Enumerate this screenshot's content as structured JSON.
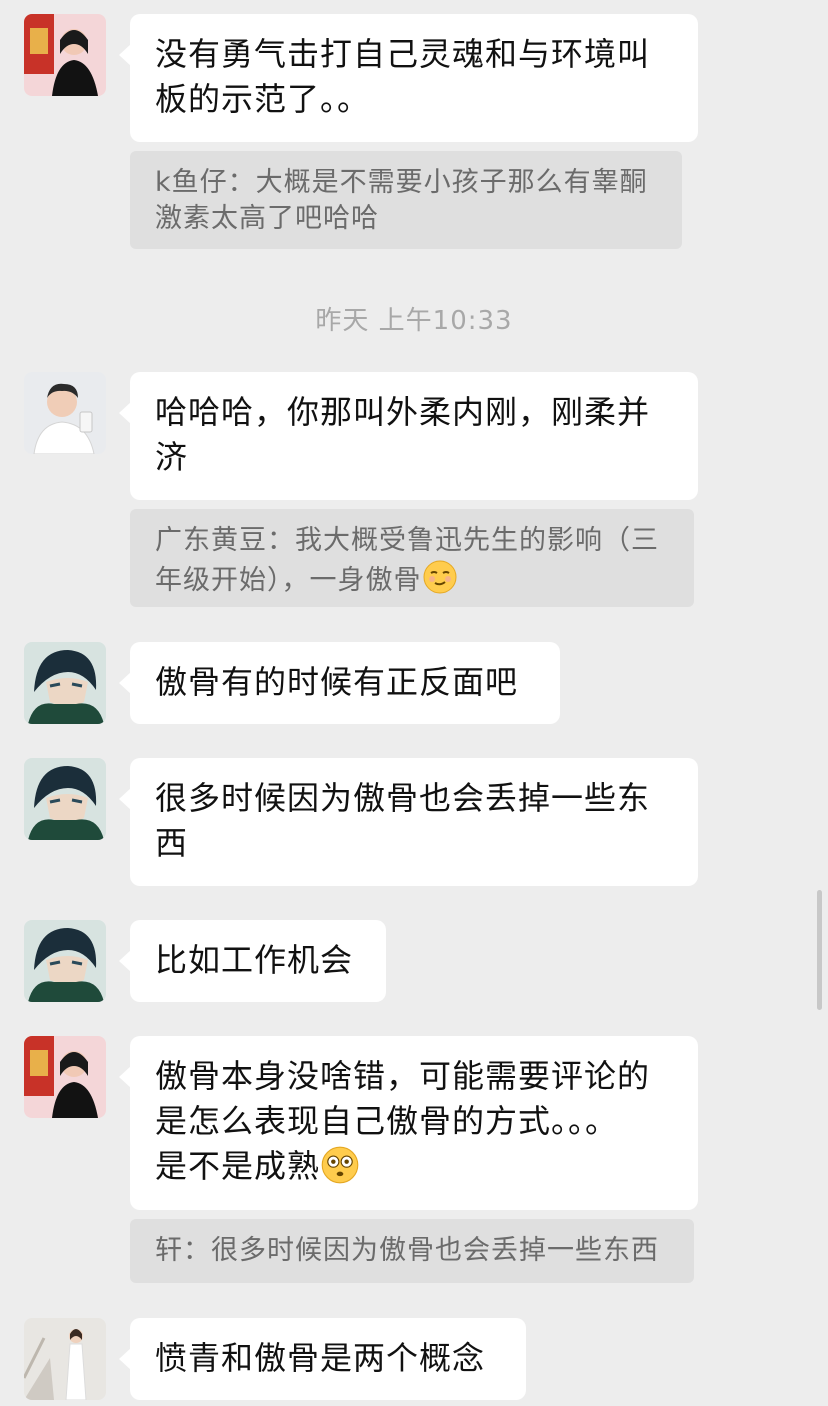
{
  "timestamp": "昨天 上午10:33",
  "messages": [
    {
      "sender": "avatar-woman-red",
      "lines": [
        "没有勇气击打自己灵魂和与环境叫",
        "板的示范了。。"
      ]
    },
    {
      "quote": [
        "k鱼仔：大概是不需要小孩子那么有睾酮",
        "激素太高了吧哈哈"
      ]
    },
    {
      "sender": "avatar-man-white",
      "lines": [
        "哈哈哈，你那叫外柔内刚，刚柔并",
        "济"
      ]
    },
    {
      "quote": [
        "广东黄豆：我大概受鲁迅先生的影响（三",
        "年级开始），一身傲骨"
      ]
    },
    {
      "sender": "avatar-anime",
      "lines": [
        "傲骨有的时候有正反面吧"
      ]
    },
    {
      "sender": "avatar-anime",
      "lines": [
        "很多时候因为傲骨也会丢掉一些东",
        "西"
      ]
    },
    {
      "sender": "avatar-anime",
      "lines": [
        "比如工作机会"
      ]
    },
    {
      "sender": "avatar-woman-red",
      "lines": [
        "傲骨本身没啥错，可能需要评论的",
        "是怎么表现自己傲骨的方式。。。",
        "是不是成熟"
      ]
    },
    {
      "quote": [
        "轩：很多时候因为傲骨也会丢掉一些东西"
      ]
    },
    {
      "sender": "avatar-woman-white",
      "lines": [
        "愤青和傲骨是两个概念"
      ]
    }
  ],
  "emojis": {
    "smirk": "smirk-emoji",
    "flushed": "flushed-emoji"
  },
  "colors": {
    "background": "#ededed",
    "bubble": "#ffffff",
    "quote_bg": "#dfdfdf",
    "text": "#111111",
    "quote_text": "#6b6b6b"
  }
}
